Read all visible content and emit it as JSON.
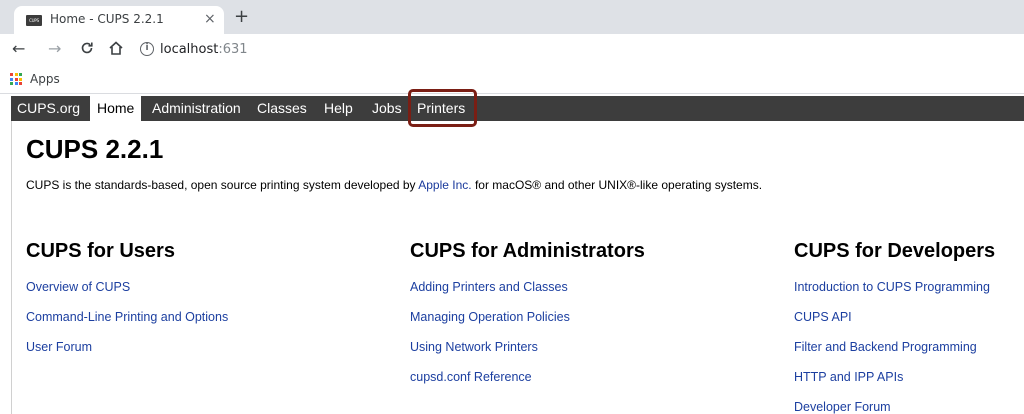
{
  "browser": {
    "tab_title": "Home - CUPS 2.2.1",
    "tab_close": "×",
    "new_tab": "+",
    "favicon_text": "CUPS",
    "url_host": "localhost",
    "url_port": ":631",
    "bookmarks": {
      "apps_label": "Apps"
    }
  },
  "cups_nav": {
    "items": [
      "CUPS.org",
      "Home",
      "Administration",
      "Classes",
      "Help",
      "Jobs",
      "Printers"
    ],
    "active": "Home",
    "highlighted": "Printers"
  },
  "page": {
    "title": "CUPS 2.2.1",
    "intro_before": "CUPS is the standards-based, open source printing system developed by ",
    "intro_link": "Apple Inc.",
    "intro_after": " for macOS® and other UNIX®-like operating systems."
  },
  "columns": [
    {
      "heading": "CUPS for Users",
      "links": [
        "Overview of CUPS",
        "Command-Line Printing and Options",
        "User Forum"
      ]
    },
    {
      "heading": "CUPS for Administrators",
      "links": [
        "Adding Printers and Classes",
        "Managing Operation Policies",
        "Using Network Printers",
        "cupsd.conf Reference"
      ]
    },
    {
      "heading": "CUPS for Developers",
      "links": [
        "Introduction to CUPS Programming",
        "CUPS API",
        "Filter and Backend Programming",
        "HTTP and IPP APIs",
        "Developer Forum"
      ]
    }
  ],
  "colors": {
    "nav_bg": "#3d3d3d",
    "link": "#1c3fa0",
    "highlight": "#7a1e14"
  }
}
